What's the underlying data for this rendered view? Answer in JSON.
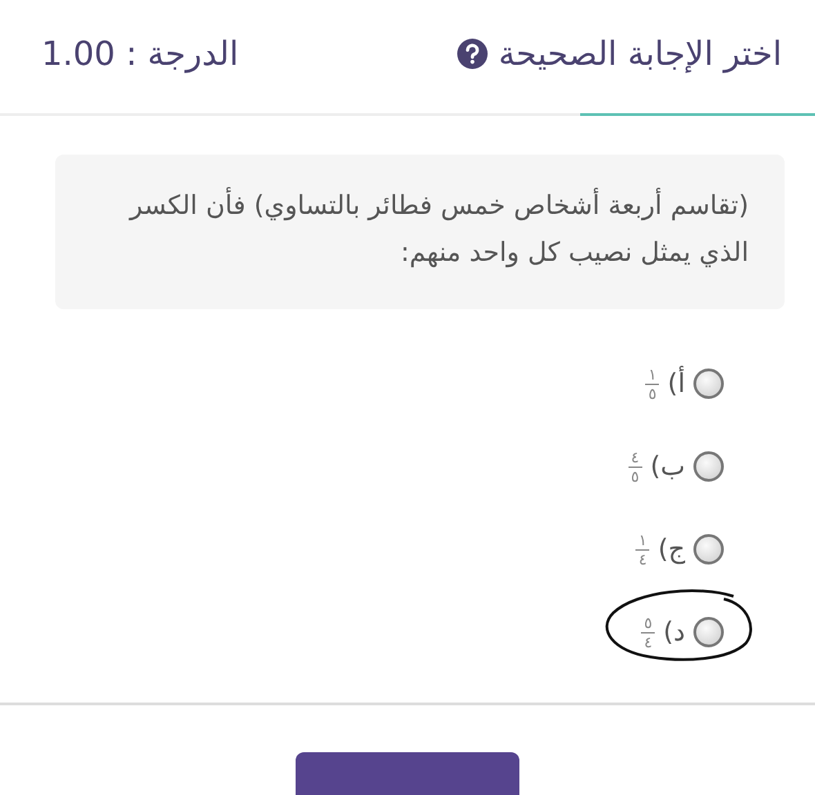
{
  "header": {
    "title": "اختر الإجابة الصحيحة",
    "score": "الدرجة : 1.00"
  },
  "question": "(تقاسم أربعة أشخاص خمس فطائر بالتساوي) فأن الكسر الذي يمثل نصيب كل واحد منهم:",
  "options": [
    {
      "letter": "أ)",
      "numerator": "١",
      "denominator": "٥",
      "selected": false,
      "circled": false
    },
    {
      "letter": "ب)",
      "numerator": "٤",
      "denominator": "٥",
      "selected": false,
      "circled": false
    },
    {
      "letter": "ج)",
      "numerator": "١",
      "denominator": "٤",
      "selected": false,
      "circled": false
    },
    {
      "letter": "د)",
      "numerator": "٥",
      "denominator": "٤",
      "selected": false,
      "circled": true
    }
  ]
}
